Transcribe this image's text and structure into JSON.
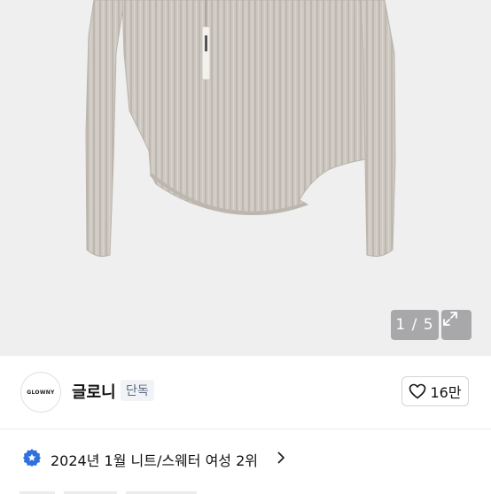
{
  "gallery": {
    "counter": "1 / 5",
    "product_image": "grey ribbed knit top with asymmetric hem",
    "expand_icon": "expand-arrows-icon"
  },
  "seller": {
    "logo_text": "GLOWNY",
    "name": "글로니",
    "badge": "단독",
    "like_icon": "heart-outline-icon",
    "like_count": "16만"
  },
  "ranking": {
    "badge_icon": "star-badge-icon",
    "text": "2024년 1월 니트/스웨터 여성 2위",
    "chevron_icon": "chevron-right-icon",
    "badge_color": "#2f6fe0"
  }
}
